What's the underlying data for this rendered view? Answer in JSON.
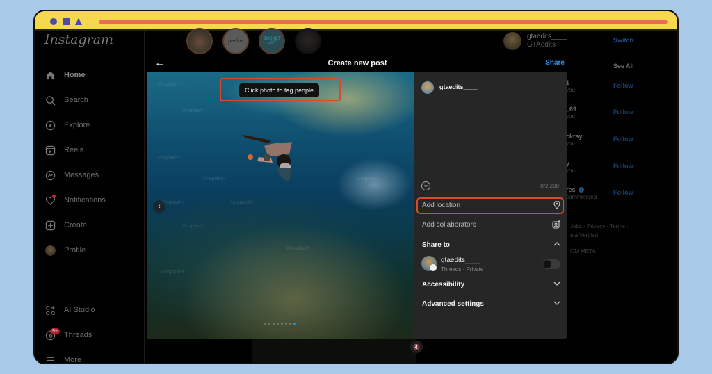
{
  "window": {
    "title_bar_colors": {
      "background": "#f6d84f",
      "bar": "#ea6b5a",
      "shapes": "#4a4aa8"
    }
  },
  "sidebar": {
    "logo": "Instagram",
    "items": [
      {
        "label": "Home",
        "icon": "home-icon"
      },
      {
        "label": "Search",
        "icon": "search-icon"
      },
      {
        "label": "Explore",
        "icon": "compass-icon"
      },
      {
        "label": "Reels",
        "icon": "reels-icon"
      },
      {
        "label": "Messages",
        "icon": "messenger-icon"
      },
      {
        "label": "Notifications",
        "icon": "heart-icon"
      },
      {
        "label": "Create",
        "icon": "plus-square-icon"
      },
      {
        "label": "Profile",
        "icon": "avatar"
      },
      {
        "label": "AI Studio",
        "icon": "ai-studio-icon"
      },
      {
        "label": "Threads",
        "icon": "threads-icon",
        "badge": "9+"
      },
      {
        "label": "More",
        "icon": "menu-icon"
      }
    ]
  },
  "stories": [
    {
      "label": ""
    },
    {
      "label": "perfos"
    },
    {
      "label": "BUCKET LIST"
    },
    {
      "label": ""
    }
  ],
  "right_column": {
    "username": "gtaedits____",
    "display_name": "GTAedits",
    "switch_label": "Switch",
    "suggested_see_all": "See All",
    "suggestions": [
      {
        "name": "1",
        "sub": "you",
        "action": "Follow"
      },
      {
        "name": "_69",
        "sub": "you",
        "action": "Follow"
      },
      {
        "name": "ckray",
        "sub": "you",
        "action": "Follow"
      },
      {
        "name": "y",
        "sub": "you",
        "action": "Follow"
      },
      {
        "name": "res",
        "sub": "commended",
        "action": "Follow",
        "verified": true
      }
    ],
    "footer_links": "Jobs · Privacy · Terms ·",
    "footer_meta_verified": "eta Verified",
    "footer_meta": "OM META"
  },
  "modal": {
    "title": "Create new post",
    "share_label": "Share",
    "photo": {
      "tag_tooltip": "Click photo to tag people",
      "watermark": "Unsplash+",
      "carousel_dots": 8,
      "active_dot": 8
    },
    "panel": {
      "username": "gtaedits____",
      "char_count": "0/2,200",
      "add_location": "Add location",
      "add_collaborators": "Add collaborators",
      "share_to": "Share to",
      "threads_account": "gtaedits____",
      "threads_sub": "Threads · Private",
      "threads_toggle": false,
      "accessibility": "Accessibility",
      "advanced_settings": "Advanced settings"
    },
    "highlight_color": "#d84a2c",
    "accent_color": "#2f8fe6"
  }
}
